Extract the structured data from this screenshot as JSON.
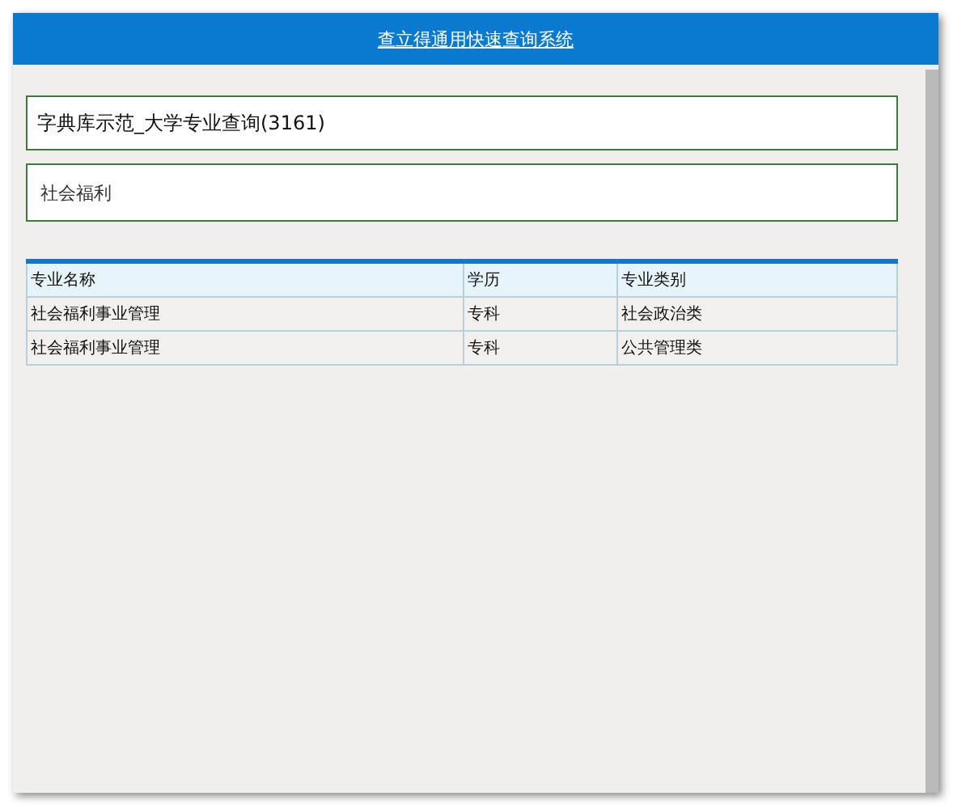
{
  "window": {
    "title": "查立得通用快速查询系统"
  },
  "database_field": {
    "value": "字典库示范_大学专业查询(3161)"
  },
  "search_field": {
    "value": "社会福利"
  },
  "table": {
    "columns": [
      "专业名称",
      "学历",
      "专业类别"
    ],
    "rows": [
      [
        "社会福利事业管理",
        "专科",
        "社会政治类"
      ],
      [
        "社会福利事业管理",
        "专科",
        "公共管理类"
      ]
    ]
  }
}
